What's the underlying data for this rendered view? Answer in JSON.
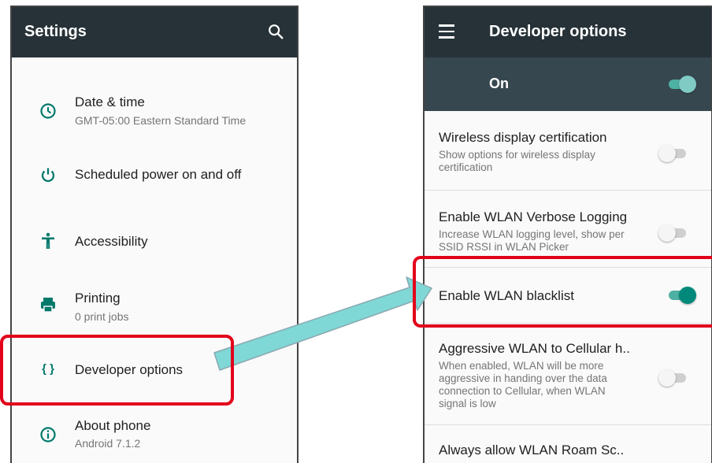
{
  "left": {
    "title": "Settings",
    "search_icon": "search-icon",
    "items": [
      {
        "icon": "clock-icon",
        "title": "Date & time",
        "subtitle": "GMT-05:00 Eastern Standard Time"
      },
      {
        "icon": "power-icon",
        "title": "Scheduled power on and off",
        "subtitle": ""
      },
      {
        "icon": "accessibility-icon",
        "title": "Accessibility",
        "subtitle": ""
      },
      {
        "icon": "printer-icon",
        "title": "Printing",
        "subtitle": "0 print jobs"
      },
      {
        "icon": "braces-icon",
        "glyph": "{ }",
        "title": "Developer options",
        "subtitle": ""
      },
      {
        "icon": "info-icon",
        "title": "About phone",
        "subtitle": "Android 7.1.2"
      }
    ]
  },
  "right": {
    "title": "Developer options",
    "master": {
      "label": "On",
      "checked": true
    },
    "prefs": [
      {
        "title": "Wireless display certification",
        "subtitle": "Show options for wireless display certification",
        "checked": false
      },
      {
        "title": "Enable WLAN Verbose Logging",
        "subtitle": "Increase WLAN logging level, show per SSID RSSI in WLAN Picker",
        "checked": false
      },
      {
        "title": "Enable WLAN blacklist",
        "subtitle": "",
        "checked": true
      },
      {
        "title": "Aggressive WLAN to Cellular h..",
        "subtitle": "When enabled, WLAN will be more aggressive in handing over the data connection to Cellular, when WLAN signal is low",
        "checked": false
      },
      {
        "title": "Always allow WLAN Roam Sc..",
        "subtitle": "",
        "checked": false
      }
    ]
  },
  "colors": {
    "appbar": "#263238",
    "accent": "#00796b",
    "highlight": "#e2001a",
    "arrow": "#7fd8d6"
  }
}
